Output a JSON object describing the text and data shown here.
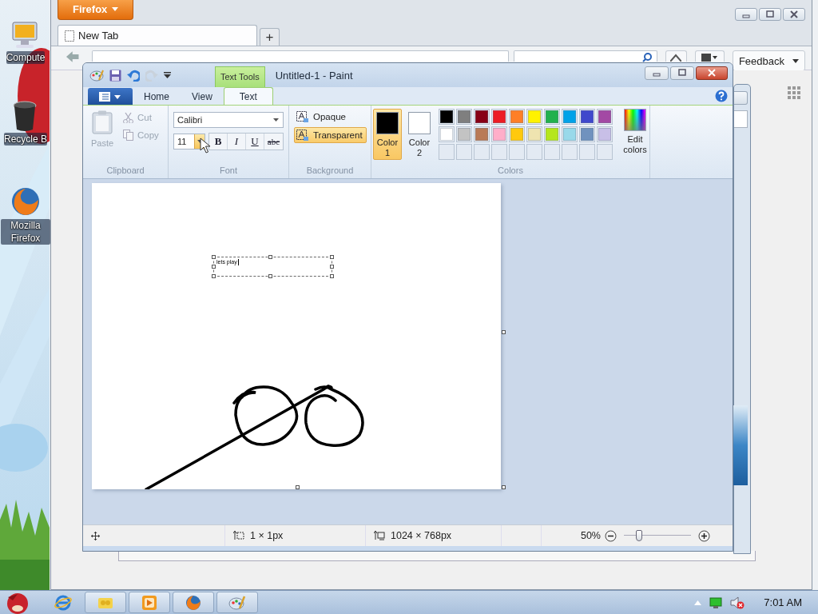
{
  "desktop_icons": [
    {
      "label": "Compute",
      "kind": "computer"
    },
    {
      "label": "Recycle B",
      "kind": "bin"
    },
    {
      "label": "Mozilla Firefox",
      "kind": "browser"
    }
  ],
  "browser": {
    "menu_button": "Firefox",
    "tabs": [
      {
        "label": "New Tab",
        "selected": true
      }
    ],
    "new_tab_button": "+",
    "feedback_button": "Feedback"
  },
  "paint": {
    "title": "Untitled-1 - Paint",
    "contextual_tab": "Text Tools",
    "tabs": [
      {
        "label": "Home",
        "selected": false
      },
      {
        "label": "View",
        "selected": false
      },
      {
        "label": "Text",
        "selected": true
      }
    ],
    "clipboard": {
      "group": "Clipboard",
      "paste": {
        "label": "Paste",
        "disabled": true
      },
      "cut": {
        "label": "Cut",
        "disabled": true
      },
      "copy": {
        "label": "Copy",
        "disabled": true
      }
    },
    "font": {
      "group": "Font",
      "family": "Calibri",
      "size": "11",
      "styles": [
        {
          "label": "B",
          "kind": "bold"
        },
        {
          "label": "I",
          "kind": "italic"
        },
        {
          "label": "U",
          "kind": "underline"
        },
        {
          "label": "abc",
          "kind": "strike"
        }
      ]
    },
    "background": {
      "group": "Background",
      "options": [
        {
          "label": "Opaque",
          "selected": false
        },
        {
          "label": "Transparent",
          "selected": true
        }
      ]
    },
    "colors": {
      "group": "Colors",
      "color1": {
        "label": "Color 1",
        "color": "#000000",
        "selected": true
      },
      "color2": {
        "label": "Color 2",
        "color": "#ffffff",
        "selected": false
      },
      "palette": [
        {
          "color": "#000000"
        },
        {
          "color": "#7f7f7f"
        },
        {
          "color": "#880015"
        },
        {
          "color": "#ed1c24"
        },
        {
          "color": "#ff7f27"
        },
        {
          "color": "#fff200"
        },
        {
          "color": "#22b14c"
        },
        {
          "color": "#00a2e8"
        },
        {
          "color": "#3f48cc"
        },
        {
          "color": "#a349a4"
        },
        {
          "color": "#ffffff"
        },
        {
          "color": "#c3c3c3"
        },
        {
          "color": "#b97a57"
        },
        {
          "color": "#ffaec9"
        },
        {
          "color": "#ffc90e"
        },
        {
          "color": "#efe4b0"
        },
        {
          "color": "#b5e61d"
        },
        {
          "color": "#99d9ea"
        },
        {
          "color": "#7092be"
        },
        {
          "color": "#c8bfe7"
        }
      ],
      "edit_colors": "Edit colors"
    },
    "canvas": {
      "text": "lets play"
    },
    "status_bar": {
      "selection": "1 × 1px",
      "image_size": "1024 × 768px",
      "zoom": "50%",
      "zoom_slider": {
        "level": 0.23
      }
    }
  },
  "taskbar": {
    "clock": "7:01 AM"
  }
}
